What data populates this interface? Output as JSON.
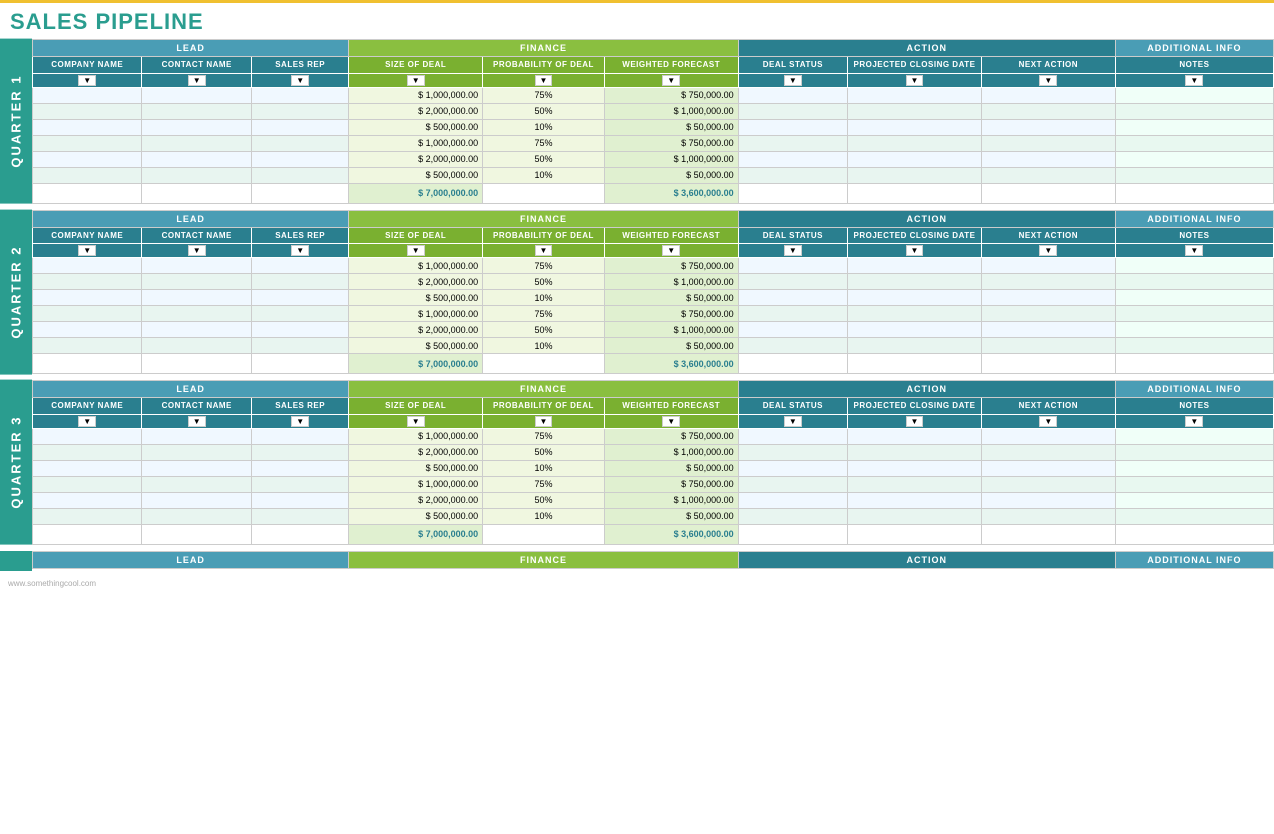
{
  "title": "SALES PIPELINE",
  "quarters": [
    {
      "label": "QUARTER 1"
    },
    {
      "label": "QUARTER 2"
    },
    {
      "label": "QUARTER 3"
    }
  ],
  "column_groups": {
    "lead": "LEAD",
    "finance": "FINANCE",
    "action": "ACTION",
    "additional_info": "ADDITIONAL INFO"
  },
  "sub_headers": {
    "company_name": "COMPANY NAME",
    "contact_name": "CONTACT NAME",
    "sales_rep": "SALES REP",
    "size_of_deal": "SIZE OF DEAL",
    "probability_of_deal": "PROBABILITY OF DEAL",
    "weighted_forecast": "WEIGHTED FORECAST",
    "deal_status": "DEAL STATUS",
    "projected_closing_date": "PROJECTED CLOSING DATE",
    "next_action": "NEXT ACTION",
    "notes": "NOTES"
  },
  "data_rows": [
    {
      "size": "$ 1,000,000.00",
      "prob": "75%",
      "weighted": "$ 750,000.00"
    },
    {
      "size": "$ 2,000,000.00",
      "prob": "50%",
      "weighted": "$ 1,000,000.00"
    },
    {
      "size": "$ 500,000.00",
      "prob": "10%",
      "weighted": "$ 50,000.00"
    },
    {
      "size": "$ 1,000,000.00",
      "prob": "75%",
      "weighted": "$ 750,000.00"
    },
    {
      "size": "$ 2,000,000.00",
      "prob": "50%",
      "weighted": "$ 1,000,000.00"
    },
    {
      "size": "$ 500,000.00",
      "prob": "10%",
      "weighted": "$ 50,000.00"
    }
  ],
  "totals": {
    "size": "$ 7,000,000.00",
    "weighted": "$ 3,600,000.00"
  },
  "footer": "www.somethingcool.com"
}
